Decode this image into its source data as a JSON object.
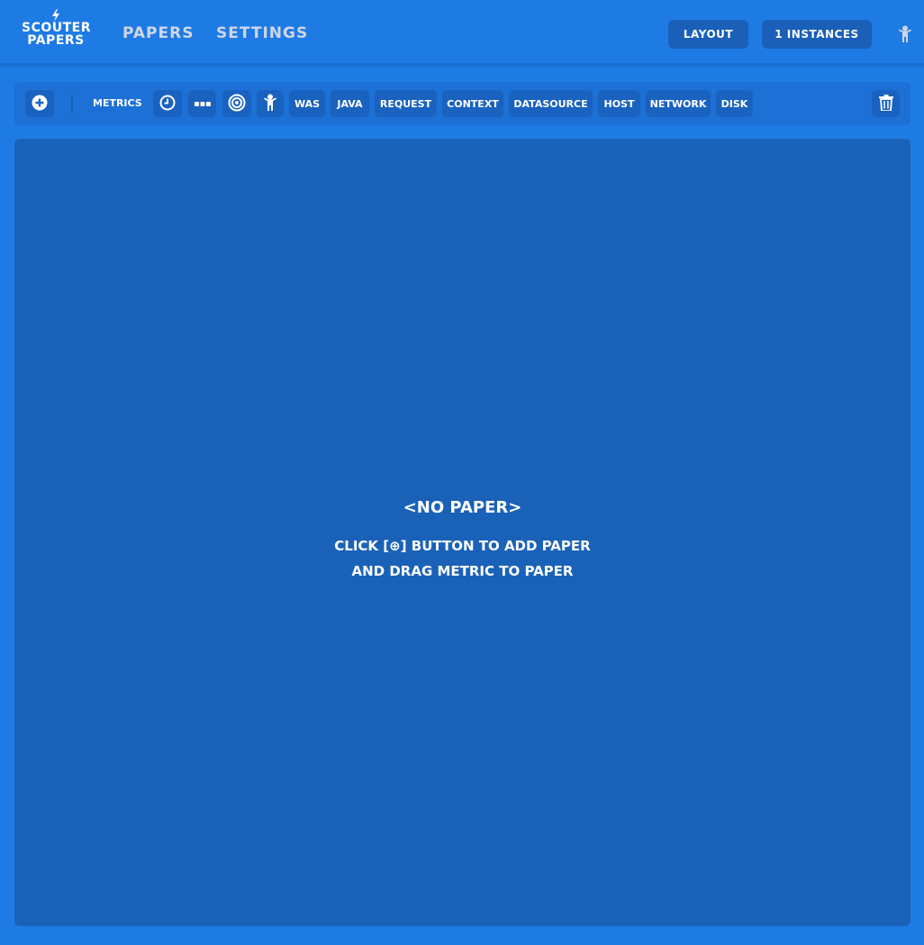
{
  "header": {
    "logo_line1": "SCOUTER",
    "logo_line2": "PAPERS",
    "logo_icon": "lightning-bolt-icon",
    "nav": [
      {
        "label": "PAPERS"
      },
      {
        "label": "SETTINGS"
      }
    ],
    "layout_label": "LAYOUT",
    "instances_label": "1 INSTANCES",
    "user_icon": "user-icon"
  },
  "toolbar": {
    "add_icon": "plus-circle-icon",
    "metrics_label": "METRICS",
    "icons": [
      "clock-icon",
      "more-dots-icon",
      "target-icon",
      "person-icon"
    ],
    "categories": [
      "WAS",
      "JAVA",
      "REQUEST",
      "CONTEXT",
      "DATASOURCE",
      "HOST",
      "NETWORK",
      "DISK"
    ],
    "trash_icon": "trash-icon"
  },
  "canvas": {
    "empty_title": "<NO PAPER>",
    "empty_line1": "CLICK [⊕] BUTTON TO ADD PAPER",
    "empty_line2": "AND DRAG METRIC TO PAPER"
  },
  "colors": {
    "background": "#1f7be4",
    "panel": "#1a62b8",
    "button": "#1a5fb8"
  }
}
